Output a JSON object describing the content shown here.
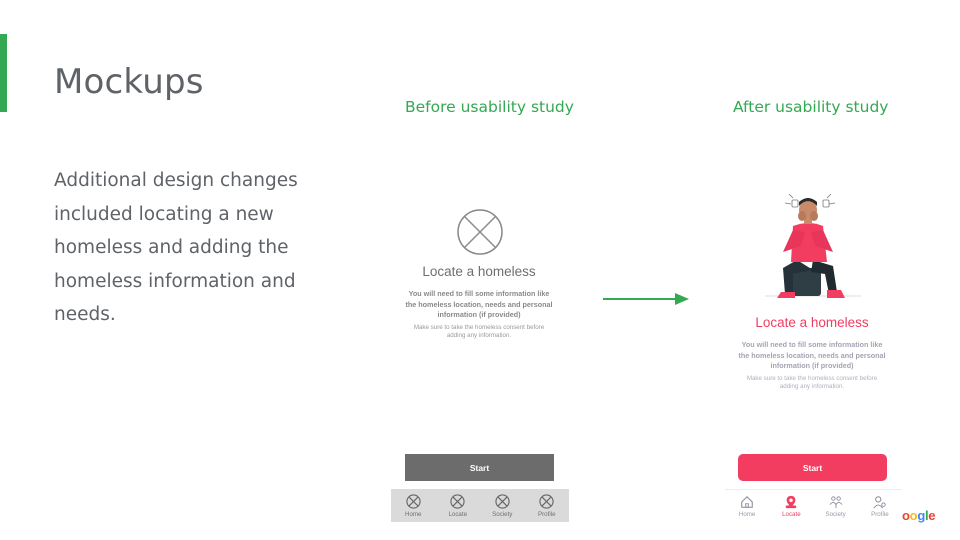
{
  "slide": {
    "title": "Mockups",
    "description": "Additional design changes included locating a new homeless and adding the homeless information and needs.",
    "before_label": "Before usability study",
    "after_label": "After usability study",
    "brand_fragment": "ogle"
  },
  "before": {
    "image_icon": "image-placeholder-icon",
    "title": "Locate a homeless",
    "body": "You will need to fill some information like the homeless location, needs and personal information (if provided)",
    "note": "Make sure to take the homeless consent before adding any information.",
    "start_label": "Start",
    "nav": [
      {
        "label": "Home",
        "icon": "placeholder-icon"
      },
      {
        "label": "Locate",
        "icon": "placeholder-icon"
      },
      {
        "label": "Society",
        "icon": "placeholder-icon"
      },
      {
        "label": "Profile",
        "icon": "placeholder-icon"
      }
    ]
  },
  "after": {
    "illustration": "stressed-person-illustration",
    "title": "Locate a homeless",
    "body": "You will need to fill some information like the homeless location, needs and personal information (if provided)",
    "note": "Make sure to take the homeless consent before adding any information.",
    "start_label": "Start",
    "nav": [
      {
        "label": "Home",
        "icon": "home-icon"
      },
      {
        "label": "Locate",
        "icon": "locate-icon",
        "active": true
      },
      {
        "label": "Society",
        "icon": "society-icon"
      },
      {
        "label": "Profile",
        "icon": "profile-icon"
      }
    ]
  },
  "colors": {
    "accent_green": "#34a853",
    "primary_pink": "#f23d61",
    "wireframe_gray": "#6c6c6c"
  }
}
